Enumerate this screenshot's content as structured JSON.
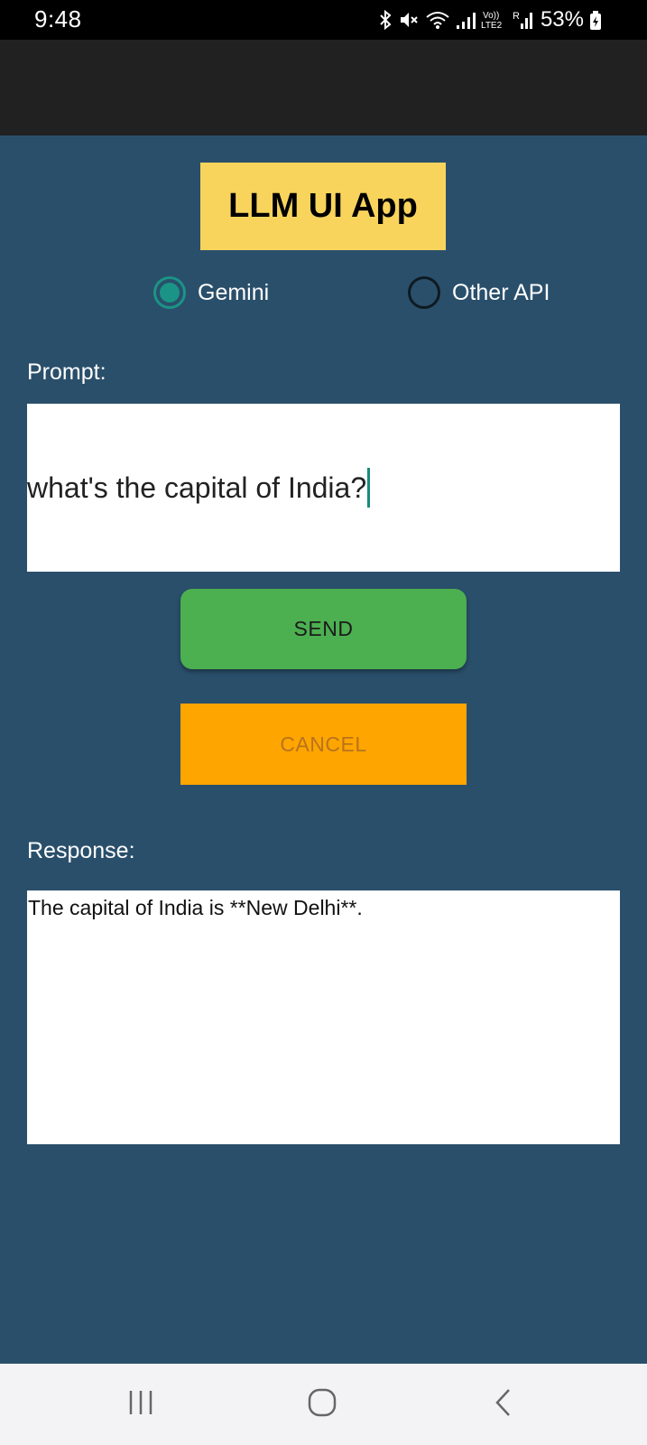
{
  "status_bar": {
    "time": "9:48",
    "battery": "53%",
    "icons": [
      "bluetooth-icon",
      "mute-icon",
      "wifi-icon",
      "signal-icon",
      "volte-icon",
      "roaming-signal-icon",
      "battery-charging-icon"
    ]
  },
  "app": {
    "title": "LLM UI App"
  },
  "model_options": {
    "gemini_label": "Gemini",
    "gemini_selected": true,
    "other_label": "Other API",
    "other_selected": false
  },
  "prompt": {
    "label": "Prompt:",
    "value": "what's the capital of India?"
  },
  "buttons": {
    "send_label": "SEND",
    "cancel_label": "CANCEL"
  },
  "response": {
    "label": "Response:",
    "value": "The capital of India is **New Delhi**."
  },
  "nav_bar": {
    "icons": [
      "recents-icon",
      "home-icon",
      "back-icon"
    ]
  },
  "colors": {
    "background": "#2a4f6b",
    "app_bar": "#212121",
    "title_bg": "#f9d45c",
    "radio_accent": "#1a9486",
    "send_bg": "#4caf50",
    "cancel_bg": "#ffa500"
  }
}
